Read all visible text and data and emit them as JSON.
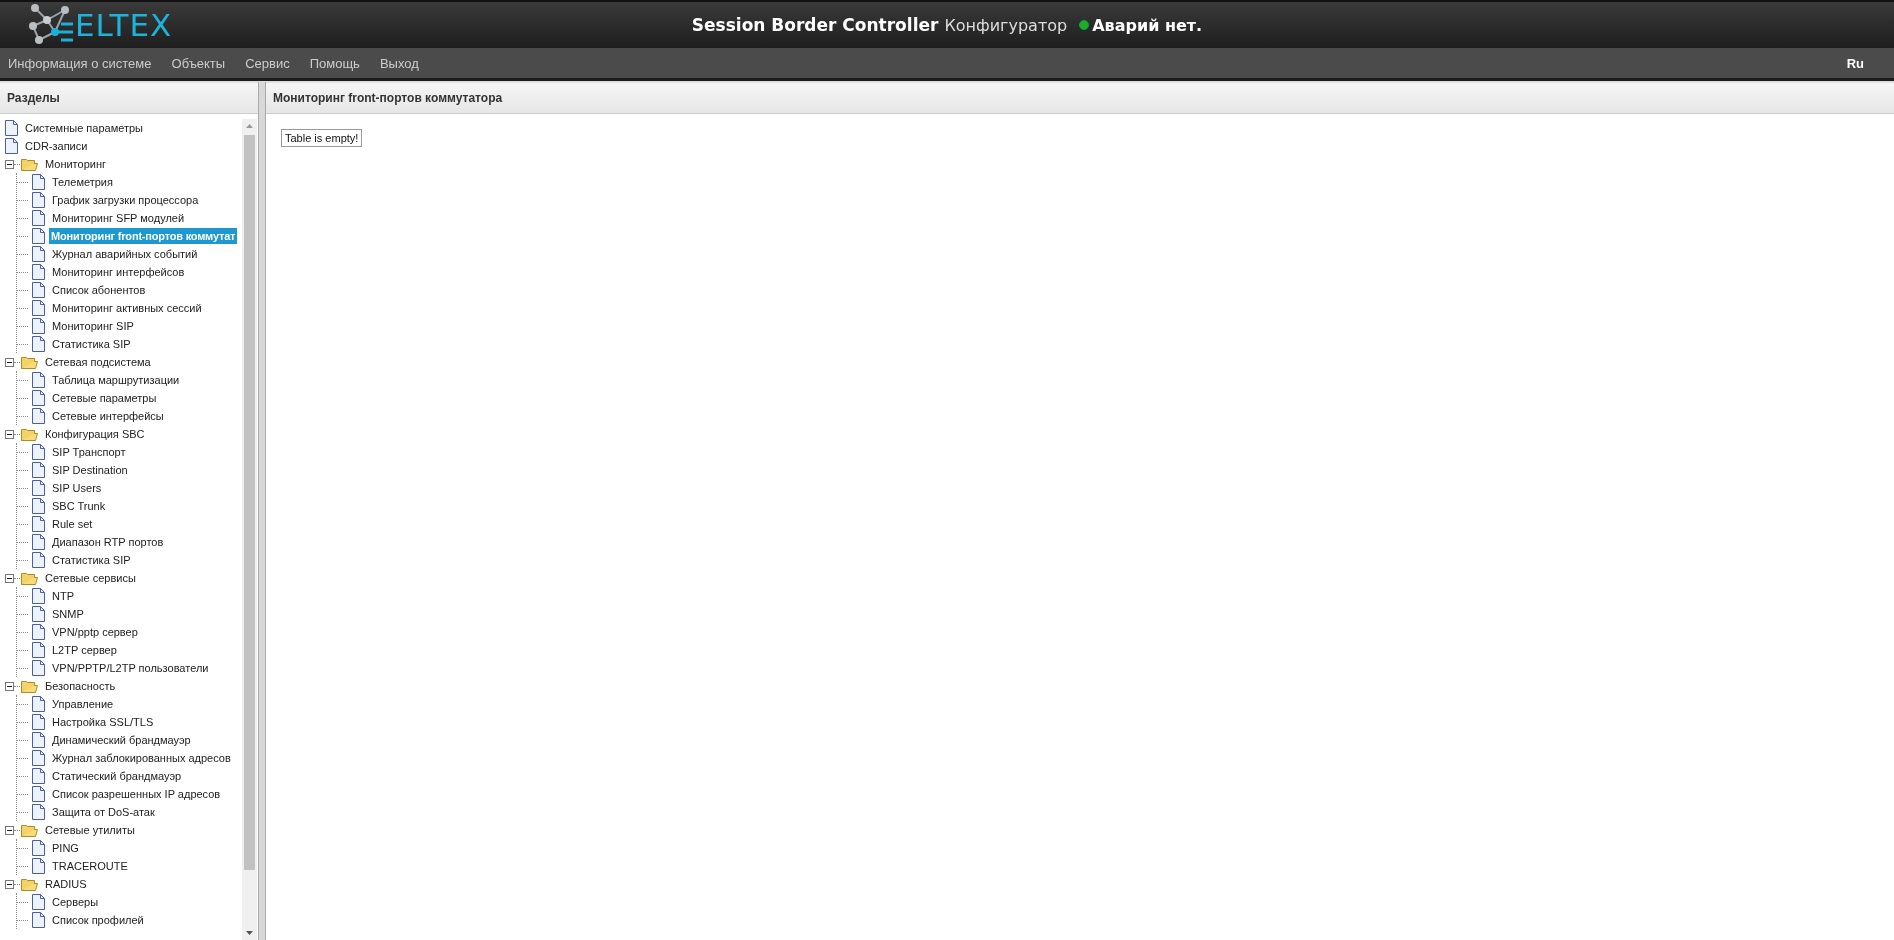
{
  "header": {
    "logo_text": "ELTEX",
    "title_bold": "Session Border Controller",
    "title_light": "Конфигуратор",
    "alarm_status": {
      "color": "#22aa22",
      "text": "Аварий нет."
    }
  },
  "menu": {
    "items": [
      {
        "label": "Информация о системе"
      },
      {
        "label": "Объекты"
      },
      {
        "label": "Сервис"
      },
      {
        "label": "Помощь"
      },
      {
        "label": "Выход"
      }
    ],
    "language": {
      "label": "Ru",
      "selected": true
    }
  },
  "sidebar": {
    "title": "Разделы",
    "items": [
      {
        "label": "Системные параметры",
        "kind": "page",
        "selected": false
      },
      {
        "label": "CDR-записи",
        "kind": "page",
        "selected": false
      },
      {
        "label": "Мониторинг",
        "kind": "folder",
        "expanded": true,
        "selected": false,
        "children": [
          {
            "label": "Телеметрия",
            "kind": "page",
            "selected": false
          },
          {
            "label": "График загрузки процессора",
            "kind": "page",
            "selected": false
          },
          {
            "label": "Мониторинг SFP модулей",
            "kind": "page",
            "selected": false
          },
          {
            "label": "Мониторинг front-портов коммутат",
            "kind": "page",
            "selected": true
          },
          {
            "label": "Журнал аварийных событий",
            "kind": "page",
            "selected": false
          },
          {
            "label": "Мониторинг интерфейсов",
            "kind": "page",
            "selected": false
          },
          {
            "label": "Список абонентов",
            "kind": "page",
            "selected": false
          },
          {
            "label": "Мониторинг активных сессий",
            "kind": "page",
            "selected": false
          },
          {
            "label": "Мониторинг SIP",
            "kind": "page",
            "selected": false
          },
          {
            "label": "Статистика SIP",
            "kind": "page",
            "selected": false
          }
        ]
      },
      {
        "label": "Сетевая подсистема",
        "kind": "folder",
        "expanded": true,
        "selected": false,
        "children": [
          {
            "label": "Таблица маршрутизации",
            "kind": "page",
            "selected": false
          },
          {
            "label": "Сетевые параметры",
            "kind": "page",
            "selected": false
          },
          {
            "label": "Сетевые интерфейсы",
            "kind": "page",
            "selected": false
          }
        ]
      },
      {
        "label": "Конфигурация SBC",
        "kind": "folder",
        "expanded": true,
        "selected": false,
        "children": [
          {
            "label": "SIP Транспорт",
            "kind": "page",
            "selected": false
          },
          {
            "label": "SIP Destination",
            "kind": "page",
            "selected": false
          },
          {
            "label": "SIP Users",
            "kind": "page",
            "selected": false
          },
          {
            "label": "SBC Trunk",
            "kind": "page",
            "selected": false
          },
          {
            "label": "Rule set",
            "kind": "page",
            "selected": false
          },
          {
            "label": "Диапазон RTP портов",
            "kind": "page",
            "selected": false
          },
          {
            "label": "Статистика SIP",
            "kind": "page",
            "selected": false
          }
        ]
      },
      {
        "label": "Сетевые сервисы",
        "kind": "folder",
        "expanded": true,
        "selected": false,
        "children": [
          {
            "label": "NTP",
            "kind": "page",
            "selected": false
          },
          {
            "label": "SNMP",
            "kind": "page",
            "selected": false
          },
          {
            "label": "VPN/pptp сервер",
            "kind": "page",
            "selected": false
          },
          {
            "label": "L2TP сервер",
            "kind": "page",
            "selected": false
          },
          {
            "label": "VPN/PPTP/L2TP пользователи",
            "kind": "page",
            "selected": false
          }
        ]
      },
      {
        "label": "Безопасность",
        "kind": "folder",
        "expanded": true,
        "selected": false,
        "children": [
          {
            "label": "Управление",
            "kind": "page",
            "selected": false
          },
          {
            "label": "Настройка SSL/TLS",
            "kind": "page",
            "selected": false
          },
          {
            "label": "Динамический брандмауэр",
            "kind": "page",
            "selected": false
          },
          {
            "label": "Журнал заблокированных адресов",
            "kind": "page",
            "selected": false
          },
          {
            "label": "Статический брандмауэр",
            "kind": "page",
            "selected": false
          },
          {
            "label": "Список разрешенных IP адресов",
            "kind": "page",
            "selected": false
          },
          {
            "label": "Защита от DoS-атак",
            "kind": "page",
            "selected": false
          }
        ]
      },
      {
        "label": "Сетевые утилиты",
        "kind": "folder",
        "expanded": true,
        "selected": false,
        "children": [
          {
            "label": "PING",
            "kind": "page",
            "selected": false
          },
          {
            "label": "TRACEROUTE",
            "kind": "page",
            "selected": false
          }
        ]
      },
      {
        "label": "RADIUS",
        "kind": "folder",
        "expanded": true,
        "selected": false,
        "children": [
          {
            "label": "Серверы",
            "kind": "page",
            "selected": false
          },
          {
            "label": "Список профилей",
            "kind": "page",
            "selected": false
          }
        ]
      }
    ]
  },
  "content": {
    "title": "Мониторинг front-портов коммутатора",
    "message": "Table is empty!"
  }
}
